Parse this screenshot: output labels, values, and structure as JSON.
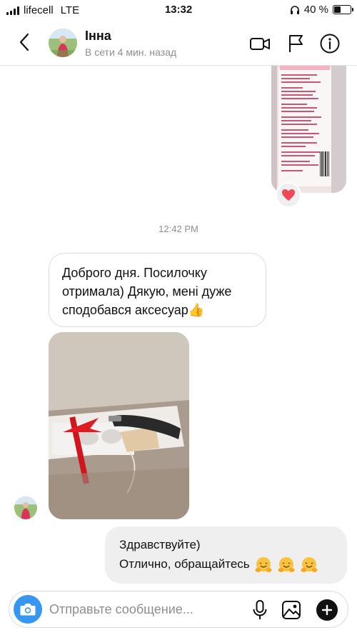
{
  "status_bar": {
    "carrier": "lifecell",
    "network": "LTE",
    "time": "13:32",
    "battery": "40 %",
    "battery_level": 0.4
  },
  "header": {
    "contact_name": "Інна",
    "presence": "В сети 4 мин. назад",
    "icons": [
      "back-icon",
      "video-call-icon",
      "flag-icon",
      "info-icon"
    ]
  },
  "conversation": {
    "top_photo_reaction": "❤️",
    "timestamp": "12:42 PM",
    "incoming_text": {
      "line1": "Доброго дня. Посилочку",
      "line2": "отримала) Дякую, мені дуже",
      "line3": "сподобався аксесуар👍"
    },
    "outgoing_text": {
      "line1": "Здравствуйте)",
      "line2": "Отлично, обращайтесь"
    }
  },
  "composer": {
    "placeholder": "Отправьте сообщение...",
    "value": "",
    "icons": [
      "camera-icon",
      "microphone-icon",
      "gallery-icon",
      "plus-icon"
    ]
  },
  "colors": {
    "accent_blue": "#3797f0",
    "incoming_border": "#dbdbdb",
    "outgoing_bg": "#efefef",
    "secondary_text": "#8e8e8e",
    "heart": "#ed4956"
  }
}
